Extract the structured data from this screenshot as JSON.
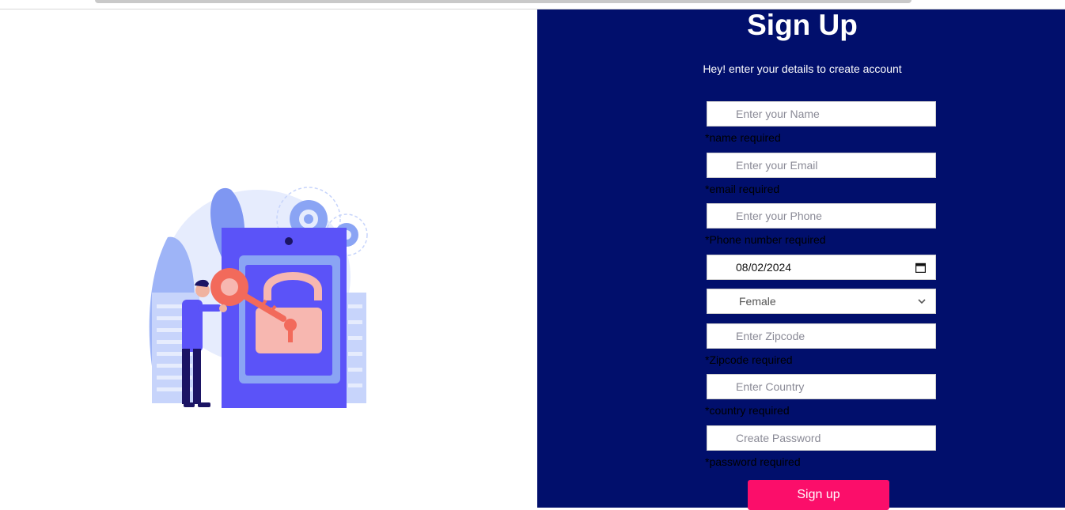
{
  "form": {
    "title": "Sign Up",
    "subtitle": "Hey! enter your details to create account",
    "name_placeholder": "Enter your Name",
    "name_error": "*name required",
    "email_placeholder": "Enter your Email",
    "email_error": "*email required",
    "phone_placeholder": "Enter your Phone",
    "phone_error": "*Phone number required",
    "date_value": "08/02/2024",
    "gender_value": "Female",
    "zipcode_placeholder": "Enter Zipcode",
    "zipcode_error": "*Zipcode required",
    "country_placeholder": "Enter Country",
    "country_error": "*country required",
    "password_placeholder": "Create Password",
    "password_error": "*password required",
    "submit_label": "Sign up"
  },
  "icons": {
    "calendar": "calendar-icon",
    "dropdown": "chevron-down-icon"
  },
  "colors": {
    "panel_bg": "#010f6c",
    "button_bg": "#fb0e6a",
    "text_white": "#ffffff"
  }
}
